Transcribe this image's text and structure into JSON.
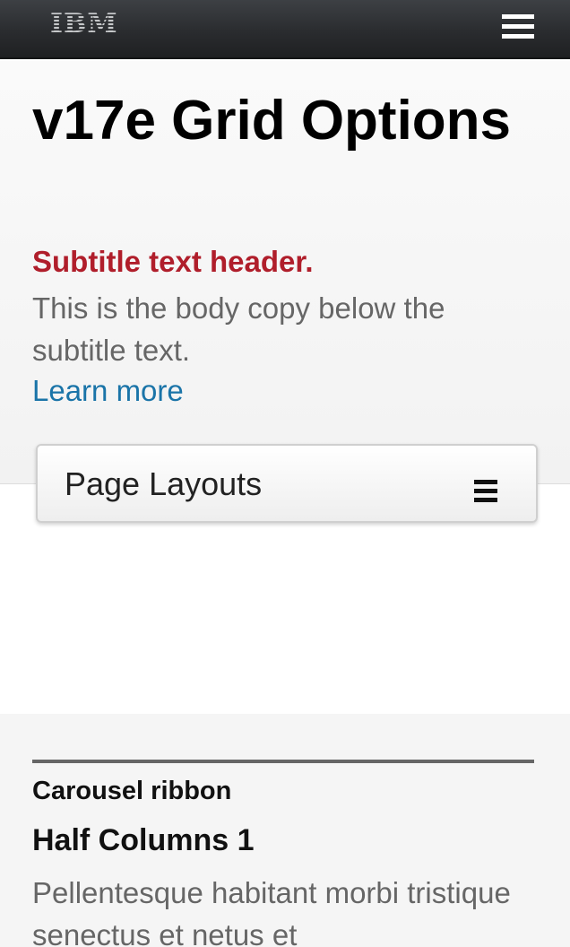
{
  "header": {
    "logo_text": "IBM",
    "menu_icon": "hamburger-menu-icon",
    "background": "#2a2c2f"
  },
  "hero": {
    "title": "v17e Grid Options",
    "subtitle": "Subtitle text header.",
    "body": "This is the body copy below the subtitle text.",
    "link": "Learn more",
    "subtitle_color": "#b01e2b",
    "link_color": "#1a74a8"
  },
  "dropdown": {
    "label": "Page Layouts",
    "icon": "list-icon"
  },
  "section": {
    "ribbon_label": "Carousel ribbon",
    "heading": "Half Columns 1",
    "body": "Pellentesque habitant morbi tristique senectus et netus et"
  }
}
